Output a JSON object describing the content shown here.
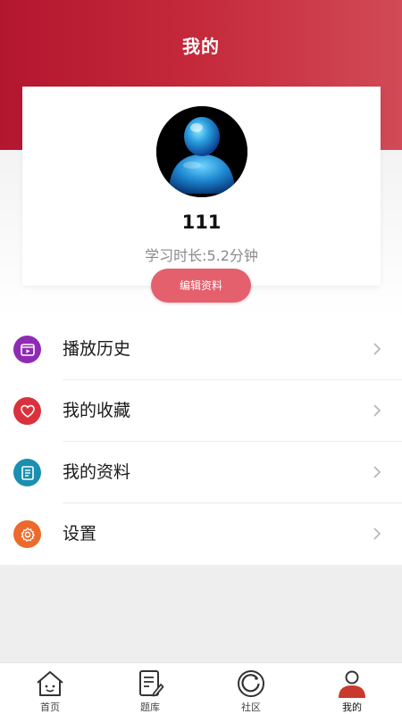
{
  "header": {
    "title": "我的"
  },
  "profile": {
    "username": "111",
    "study_time": "学习时长:5.2分钟",
    "edit_button_label": "编辑资料"
  },
  "menu": {
    "items": [
      {
        "label": "播放历史",
        "icon": "play-history-icon",
        "color": "#8f2bb3"
      },
      {
        "label": "我的收藏",
        "icon": "heart-icon",
        "color": "#d9323d"
      },
      {
        "label": "我的资料",
        "icon": "document-icon",
        "color": "#1a8fb0"
      },
      {
        "label": "设置",
        "icon": "gear-icon",
        "color": "#ec6a2b"
      }
    ]
  },
  "tabbar": {
    "tabs": [
      {
        "label": "首页",
        "icon": "home-icon"
      },
      {
        "label": "题库",
        "icon": "question-bank-icon"
      },
      {
        "label": "社区",
        "icon": "community-icon"
      },
      {
        "label": "我的",
        "icon": "profile-icon",
        "active": true
      }
    ]
  },
  "colors": {
    "header_red": "#b3162f",
    "button_pink": "#e4606d",
    "active_tab": "#c83a2e"
  }
}
